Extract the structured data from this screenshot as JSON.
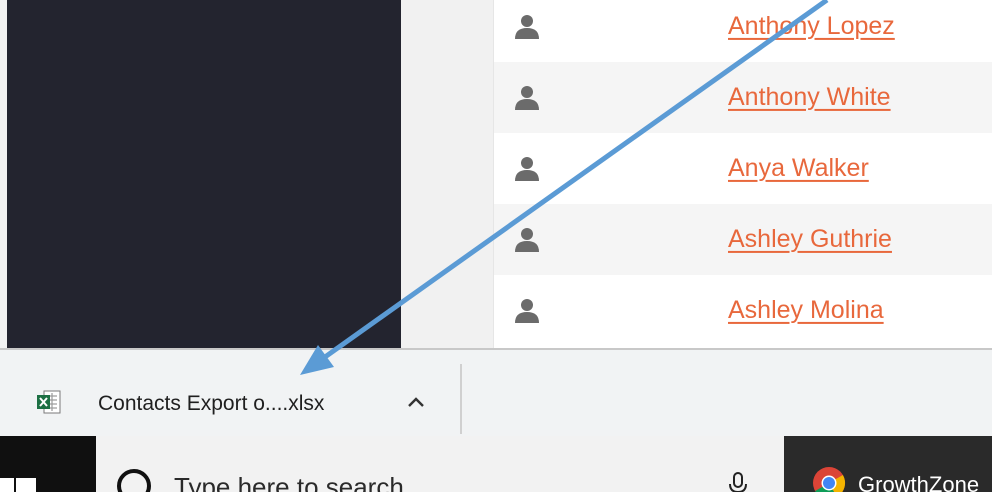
{
  "contacts": [
    {
      "name": "Anthony Lopez"
    },
    {
      "name": "Anthony White"
    },
    {
      "name": "Anya Walker"
    },
    {
      "name": "Ashley Guthrie"
    },
    {
      "name": "Ashley Molina"
    }
  ],
  "download_bar": {
    "file_name": "Contacts Export o....xlsx",
    "file_icon": "excel-file-icon",
    "menu_icon": "chevron-up-icon"
  },
  "taskbar": {
    "search_placeholder": "Type here to search",
    "chrome_label": "GrowthZone",
    "start_icon": "windows-icon",
    "search_icon": "search-icon",
    "mic_icon": "microphone-icon"
  },
  "colors": {
    "link": "#e8683c",
    "nav_dark": "#23242f",
    "arrow": "#5b9bd5",
    "taskbar": "#101010"
  }
}
